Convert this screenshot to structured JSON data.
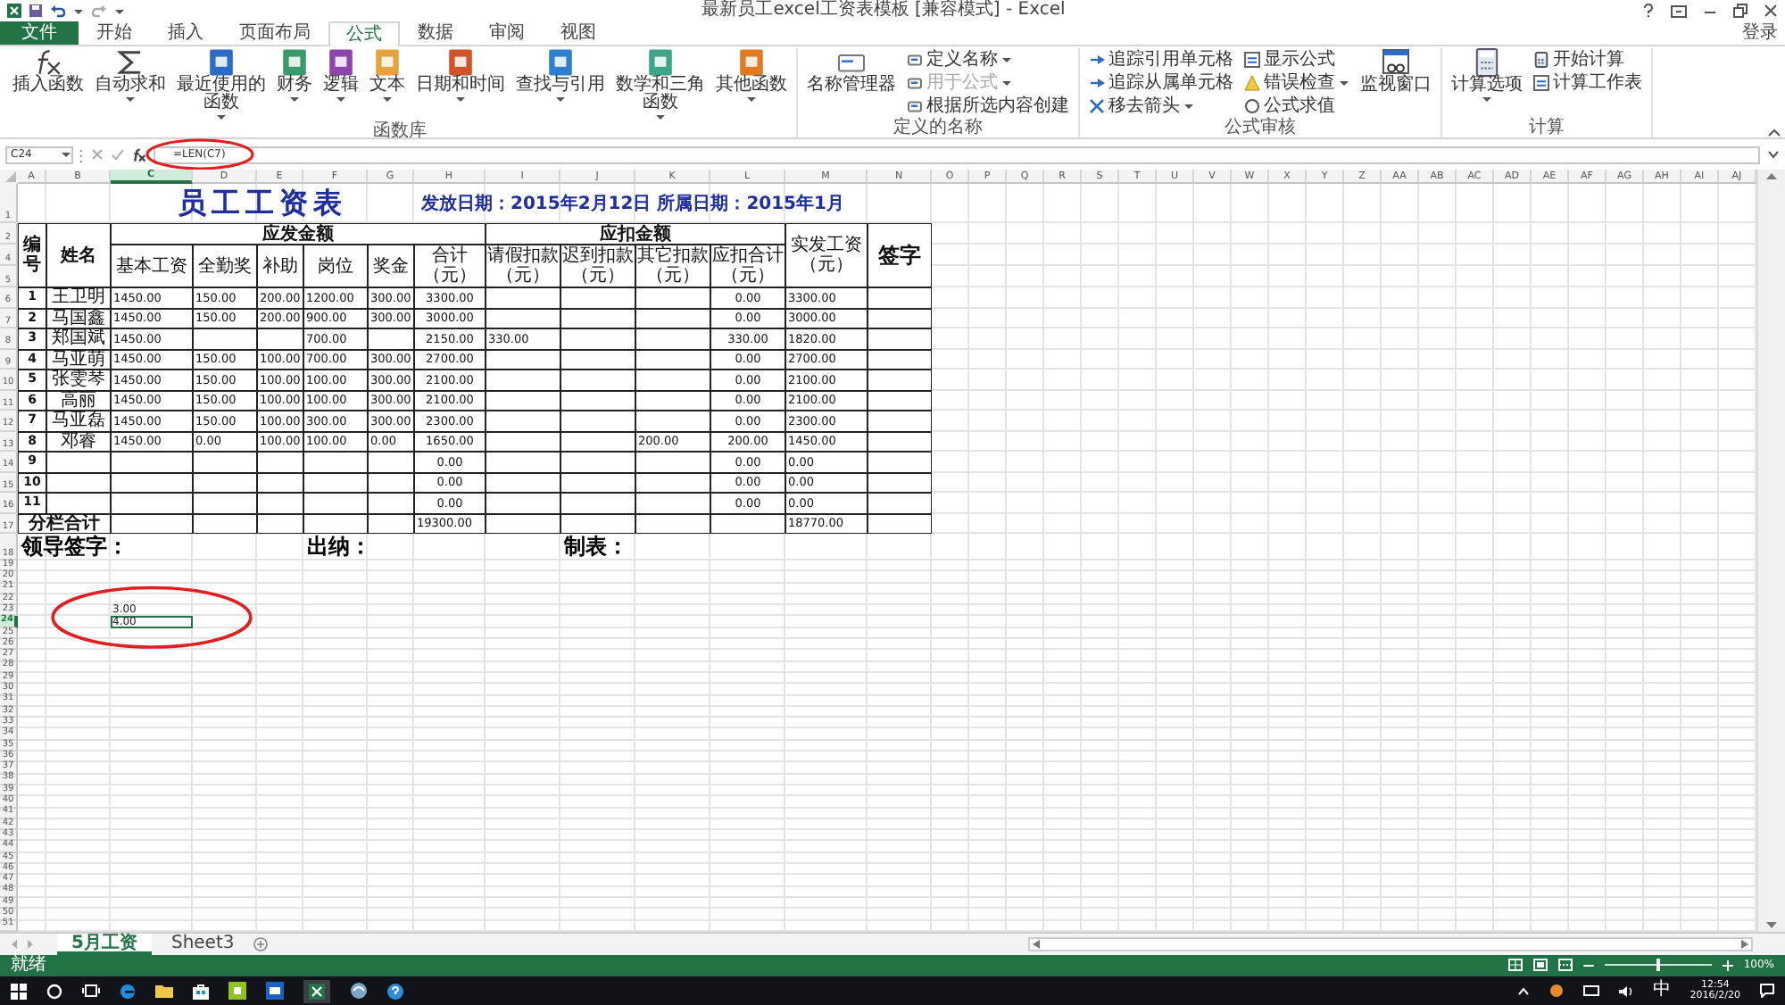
{
  "window": {
    "title": "最新员工excel工资表模板 [兼容模式] - Excel",
    "sign_in": "登录"
  },
  "ribbon_tabs": [
    {
      "label": "文件",
      "kind": "file",
      "selected": false
    },
    {
      "label": "开始",
      "kind": "tab",
      "selected": false
    },
    {
      "label": "插入",
      "kind": "tab",
      "selected": false
    },
    {
      "label": "页面布局",
      "kind": "tab",
      "selected": false
    },
    {
      "label": "公式",
      "kind": "tab",
      "selected": true
    },
    {
      "label": "数据",
      "kind": "tab",
      "selected": false
    },
    {
      "label": "审阅",
      "kind": "tab",
      "selected": false
    },
    {
      "label": "视图",
      "kind": "tab",
      "selected": false
    }
  ],
  "ribbon_groups": [
    {
      "label": "函数库",
      "items": [
        {
          "label": "插入函数",
          "kind": "large",
          "dropdown": false,
          "disabled": false
        },
        {
          "label": "自动求和",
          "kind": "large",
          "dropdown": true,
          "disabled": false
        },
        {
          "label": "最近使用的函数",
          "kind": "large",
          "dropdown": true,
          "disabled": false
        },
        {
          "label": "财务",
          "kind": "large",
          "dropdown": true,
          "disabled": false
        },
        {
          "label": "逻辑",
          "kind": "large",
          "dropdown": true,
          "disabled": false
        },
        {
          "label": "文本",
          "kind": "large",
          "dropdown": true,
          "disabled": false
        },
        {
          "label": "日期和时间",
          "kind": "large",
          "dropdown": true,
          "disabled": false
        },
        {
          "label": "查找与引用",
          "kind": "large",
          "dropdown": true,
          "disabled": false
        },
        {
          "label": "数学和三角函数",
          "kind": "large",
          "dropdown": true,
          "disabled": false
        },
        {
          "label": "其他函数",
          "kind": "large",
          "dropdown": true,
          "disabled": false
        }
      ]
    },
    {
      "label": "定义的名称",
      "items": [
        {
          "label": "名称管理器",
          "kind": "large",
          "dropdown": false,
          "disabled": false
        },
        {
          "label": "定义名称",
          "kind": "small",
          "dropdown": true,
          "disabled": false
        },
        {
          "label": "用于公式",
          "kind": "small",
          "dropdown": true,
          "disabled": true
        },
        {
          "label": "根据所选内容创建",
          "kind": "small",
          "dropdown": false,
          "disabled": false
        }
      ]
    },
    {
      "label": "公式审核",
      "items": [
        {
          "label": "追踪引用单元格",
          "kind": "small",
          "dropdown": false,
          "disabled": false
        },
        {
          "label": "追踪从属单元格",
          "kind": "small",
          "dropdown": false,
          "disabled": false
        },
        {
          "label": "移去箭头",
          "kind": "small",
          "dropdown": true,
          "disabled": false
        },
        {
          "label": "显示公式",
          "kind": "small",
          "dropdown": false,
          "disabled": false
        },
        {
          "label": "错误检查",
          "kind": "small",
          "dropdown": true,
          "disabled": false
        },
        {
          "label": "公式求值",
          "kind": "small",
          "dropdown": false,
          "disabled": false
        },
        {
          "label": "监视窗口",
          "kind": "large",
          "dropdown": false,
          "disabled": false
        }
      ]
    },
    {
      "label": "计算",
      "items": [
        {
          "label": "计算选项",
          "kind": "large",
          "dropdown": true,
          "disabled": false
        },
        {
          "label": "开始计算",
          "kind": "small",
          "dropdown": false,
          "disabled": false
        },
        {
          "label": "计算工作表",
          "kind": "small",
          "dropdown": false,
          "disabled": false
        }
      ]
    }
  ],
  "formula_bar": {
    "name_box": "C24",
    "formula": "=LEN(C7)"
  },
  "sheet": {
    "columns": [
      {
        "label": "A",
        "selected": false
      },
      {
        "label": "B",
        "selected": false
      },
      {
        "label": "C",
        "selected": true
      },
      {
        "label": "D",
        "selected": false
      },
      {
        "label": "E",
        "selected": false
      },
      {
        "label": "F",
        "selected": false
      },
      {
        "label": "G",
        "selected": false
      },
      {
        "label": "H",
        "selected": false
      },
      {
        "label": "I",
        "selected": false
      },
      {
        "label": "J",
        "selected": false
      },
      {
        "label": "K",
        "selected": false
      },
      {
        "label": "L",
        "selected": false
      },
      {
        "label": "M",
        "selected": false
      },
      {
        "label": "N",
        "selected": false
      },
      {
        "label": "O",
        "selected": false
      },
      {
        "label": "P",
        "selected": false
      },
      {
        "label": "Q",
        "selected": false
      },
      {
        "label": "R",
        "selected": false
      },
      {
        "label": "S",
        "selected": false
      },
      {
        "label": "T",
        "selected": false
      },
      {
        "label": "U",
        "selected": false
      },
      {
        "label": "V",
        "selected": false
      },
      {
        "label": "W",
        "selected": false
      },
      {
        "label": "X",
        "selected": false
      },
      {
        "label": "Y",
        "selected": false
      },
      {
        "label": "Z",
        "selected": false
      },
      {
        "label": "AA",
        "selected": false
      },
      {
        "label": "AB",
        "selected": false
      },
      {
        "label": "AC",
        "selected": false
      },
      {
        "label": "AD",
        "selected": false
      },
      {
        "label": "AE",
        "selected": false
      },
      {
        "label": "AF",
        "selected": false
      },
      {
        "label": "AG",
        "selected": false
      },
      {
        "label": "AH",
        "selected": false
      },
      {
        "label": "AI",
        "selected": false
      },
      {
        "label": "AJ",
        "selected": false
      }
    ],
    "row_numbers": [
      {
        "label": "1",
        "selected": false
      },
      {
        "label": "2",
        "selected": false
      },
      {
        "label": "4",
        "selected": false
      },
      {
        "label": "5",
        "selected": false
      },
      {
        "label": "6",
        "selected": false
      },
      {
        "label": "7",
        "selected": false
      },
      {
        "label": "8",
        "selected": false
      },
      {
        "label": "9",
        "selected": false
      },
      {
        "label": "10",
        "selected": false
      },
      {
        "label": "11",
        "selected": false
      },
      {
        "label": "12",
        "selected": false
      },
      {
        "label": "13",
        "selected": false
      },
      {
        "label": "14",
        "selected": false
      },
      {
        "label": "15",
        "selected": false
      },
      {
        "label": "16",
        "selected": false
      },
      {
        "label": "17",
        "selected": false
      },
      {
        "label": "18",
        "selected": false
      },
      {
        "label": "19",
        "selected": false
      },
      {
        "label": "20",
        "selected": false
      },
      {
        "label": "21",
        "selected": false
      },
      {
        "label": "22",
        "selected": false
      },
      {
        "label": "23",
        "selected": false
      },
      {
        "label": "24",
        "selected": true
      },
      {
        "label": "25",
        "selected": false
      },
      {
        "label": "26",
        "selected": false
      },
      {
        "label": "27",
        "selected": false
      },
      {
        "label": "28",
        "selected": false
      },
      {
        "label": "29",
        "selected": false
      },
      {
        "label": "30",
        "selected": false
      },
      {
        "label": "31",
        "selected": false
      },
      {
        "label": "32",
        "selected": false
      },
      {
        "label": "33",
        "selected": false
      },
      {
        "label": "34",
        "selected": false
      },
      {
        "label": "35",
        "selected": false
      },
      {
        "label": "36",
        "selected": false
      },
      {
        "label": "37",
        "selected": false
      },
      {
        "label": "38",
        "selected": false
      },
      {
        "label": "39",
        "selected": false
      },
      {
        "label": "40",
        "selected": false
      },
      {
        "label": "41",
        "selected": false
      },
      {
        "label": "42",
        "selected": false
      },
      {
        "label": "43",
        "selected": false
      },
      {
        "label": "44",
        "selected": false
      },
      {
        "label": "45",
        "selected": false
      },
      {
        "label": "46",
        "selected": false
      },
      {
        "label": "47",
        "selected": false
      },
      {
        "label": "48",
        "selected": false
      },
      {
        "label": "49",
        "selected": false
      },
      {
        "label": "50",
        "selected": false
      },
      {
        "label": "51",
        "selected": false
      }
    ],
    "title": "员工工资表",
    "date_note": "发放日期：2015年2月12日  所属日期：2015年1月",
    "header": {
      "no": "编号",
      "name": "姓名",
      "gross_group": "应发金额",
      "deduct_group": "应扣金额",
      "net": "实发工资（元）",
      "sign": "签字",
      "sub": [
        "基本工资",
        "全勤奖",
        "补助",
        "岗位",
        "奖金",
        "合计（元）",
        "请假扣款（元）",
        "迟到扣款（元）",
        "其它扣款（元）",
        "应扣合计（元）"
      ]
    },
    "rows": [
      {
        "no": "1",
        "name": "王卫明",
        "values": {
          "C": "1450.00",
          "D": "150.00",
          "E": "200.00",
          "F": "1200.00",
          "G": "300.00",
          "H": "3300.00",
          "L": "0.00",
          "M": "3300.00"
        }
      },
      {
        "no": "2",
        "name": "马国鑫",
        "values": {
          "C": "1450.00",
          "D": "150.00",
          "E": "200.00",
          "F": "900.00",
          "G": "300.00",
          "H": "3000.00",
          "L": "0.00",
          "M": "3000.00"
        }
      },
      {
        "no": "3",
        "name": "郑国斌",
        "values": {
          "C": "1450.00",
          "F": "700.00",
          "H": "2150.00",
          "I": "330.00",
          "L": "330.00",
          "M": "1820.00"
        }
      },
      {
        "no": "4",
        "name": "马亚萌",
        "values": {
          "C": "1450.00",
          "D": "150.00",
          "E": "100.00",
          "F": "700.00",
          "G": "300.00",
          "H": "2700.00",
          "L": "0.00",
          "M": "2700.00"
        }
      },
      {
        "no": "5",
        "name": "张雯琴",
        "values": {
          "C": "1450.00",
          "D": "150.00",
          "E": "100.00",
          "F": "100.00",
          "G": "300.00",
          "H": "2100.00",
          "L": "0.00",
          "M": "2100.00"
        }
      },
      {
        "no": "6",
        "name": "高丽",
        "values": {
          "C": "1450.00",
          "D": "150.00",
          "E": "100.00",
          "F": "100.00",
          "G": "300.00",
          "H": "2100.00",
          "L": "0.00",
          "M": "2100.00"
        }
      },
      {
        "no": "7",
        "name": "马亚磊",
        "values": {
          "C": "1450.00",
          "D": "150.00",
          "E": "100.00",
          "F": "300.00",
          "G": "300.00",
          "H": "2300.00",
          "L": "0.00",
          "M": "2300.00"
        }
      },
      {
        "no": "8",
        "name": "邓睿",
        "values": {
          "C": "1450.00",
          "D": "0.00",
          "E": "100.00",
          "F": "100.00",
          "G": "0.00",
          "H": "1650.00",
          "K": "200.00",
          "L": "200.00",
          "M": "1450.00"
        }
      },
      {
        "no": "9",
        "values": {
          "H": "0.00",
          "L": "0.00",
          "M": "0.00"
        }
      },
      {
        "no": "10",
        "values": {
          "H": "0.00",
          "L": "0.00",
          "M": "0.00"
        }
      },
      {
        "no": "11",
        "values": {
          "H": "0.00",
          "L": "0.00",
          "M": "0.00"
        }
      }
    ],
    "total": {
      "label": "分栏合计",
      "values": {
        "H": "19300.00",
        "M": "18770.00"
      }
    },
    "signatures": [
      "领导签字：",
      "出纳：",
      "制表："
    ],
    "loose_cells": [
      {
        "text": "3.00",
        "selected": false
      },
      {
        "text": "4.00",
        "selected": true
      }
    ]
  },
  "sheet_tabs": [
    {
      "label": "5月工资",
      "selected": true
    },
    {
      "label": "Sheet3",
      "selected": false
    }
  ],
  "status_bar": {
    "status": "就绪",
    "zoom": "100%",
    "zoom_slider": {
      "level": 0.5
    }
  },
  "taskbar": {
    "ime": "中",
    "time": "12:54",
    "date": "2016/2/20"
  }
}
